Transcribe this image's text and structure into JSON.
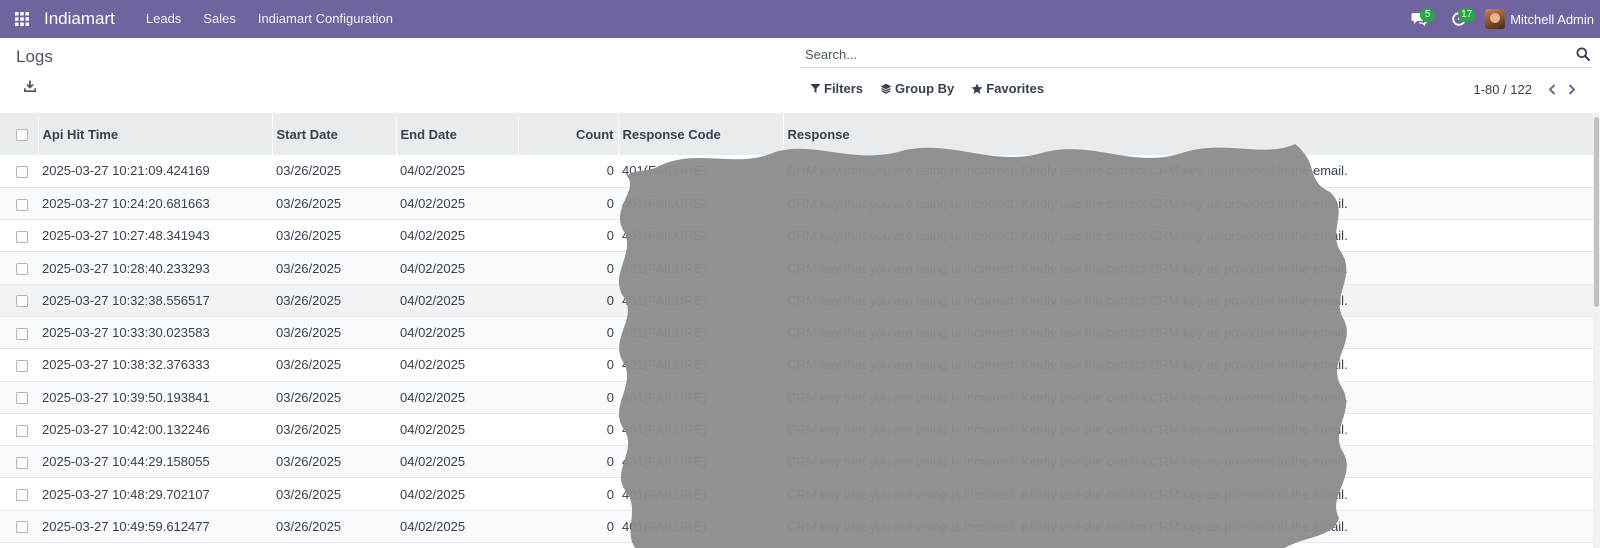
{
  "navbar": {
    "brand": "Indiamart",
    "menu": [
      "Leads",
      "Sales",
      "Indiamart Configuration"
    ],
    "messages_badge": "5",
    "activities_badge": "17",
    "user_name": "Mitchell Admin"
  },
  "control_panel": {
    "title": "Logs",
    "search_placeholder": "Search...",
    "filters_label": "Filters",
    "groupby_label": "Group By",
    "favorites_label": "Favorites",
    "pager_value": "1-80 / 122"
  },
  "table": {
    "headers": {
      "api_hit_time": "Api Hit Time",
      "start_date": "Start Date",
      "end_date": "End Date",
      "count": "Count",
      "response_code": "Response Code",
      "response": "Response"
    },
    "rows": [
      {
        "api_hit_time": "2025-03-27 10:21:09.424169",
        "start_date": "03/26/2025",
        "end_date": "04/02/2025",
        "count": "0",
        "response_code": "401(FAILURE)",
        "response": "CRM key that you are using is incorrect. Kindly use the correct CRM key as provided in the email."
      },
      {
        "api_hit_time": "2025-03-27 10:24:20.681663",
        "start_date": "03/26/2025",
        "end_date": "04/02/2025",
        "count": "0",
        "response_code": "401(FAILURE)",
        "response": "CRM key that you are using is incorrect. Kindly use the correct CRM key as provided in the email."
      },
      {
        "api_hit_time": "2025-03-27 10:27:48.341943",
        "start_date": "03/26/2025",
        "end_date": "04/02/2025",
        "count": "0",
        "response_code": "401(FAILURE)",
        "response": "CRM key that you are using is incorrect. Kindly use the correct CRM key as provided in the email."
      },
      {
        "api_hit_time": "2025-03-27 10:28:40.233293",
        "start_date": "03/26/2025",
        "end_date": "04/02/2025",
        "count": "0",
        "response_code": "401(FAILURE)",
        "response": "CRM key that you are using is incorrect. Kindly use the correct CRM key as provided in the email."
      },
      {
        "api_hit_time": "2025-03-27 10:32:38.556517",
        "start_date": "03/26/2025",
        "end_date": "04/02/2025",
        "count": "0",
        "response_code": "401(FAILURE)",
        "response": "CRM key that you are using is incorrect. Kindly use the correct CRM key as provided in the email."
      },
      {
        "api_hit_time": "2025-03-27 10:33:30.023583",
        "start_date": "03/26/2025",
        "end_date": "04/02/2025",
        "count": "0",
        "response_code": "401(FAILURE)",
        "response": "CRM key that you are using is incorrect. Kindly use the correct CRM key as provided in the email."
      },
      {
        "api_hit_time": "2025-03-27 10:38:32.376333",
        "start_date": "03/26/2025",
        "end_date": "04/02/2025",
        "count": "0",
        "response_code": "401(FAILURE)",
        "response": "CRM key that you are using is incorrect. Kindly use the correct CRM key as provided in the email."
      },
      {
        "api_hit_time": "2025-03-27 10:39:50.193841",
        "start_date": "03/26/2025",
        "end_date": "04/02/2025",
        "count": "0",
        "response_code": "401(FAILURE)",
        "response": "CRM key that you are using is incorrect. Kindly use the correct CRM key as provided in the email."
      },
      {
        "api_hit_time": "2025-03-27 10:42:00.132246",
        "start_date": "03/26/2025",
        "end_date": "04/02/2025",
        "count": "0",
        "response_code": "401(FAILURE)",
        "response": "CRM key that you are using is incorrect. Kindly use the correct CRM key as provided in the email."
      },
      {
        "api_hit_time": "2025-03-27 10:44:29.158055",
        "start_date": "03/26/2025",
        "end_date": "04/02/2025",
        "count": "0",
        "response_code": "401(FAILURE)",
        "response": "CRM key that you are using is incorrect. Kindly use the correct CRM key as provided in the email."
      },
      {
        "api_hit_time": "2025-03-27 10:48:29.702107",
        "start_date": "03/26/2025",
        "end_date": "04/02/2025",
        "count": "0",
        "response_code": "401(FAILURE)",
        "response": "CRM key that you are using is incorrect. Kindly use the correct CRM key as provided in the email."
      },
      {
        "api_hit_time": "2025-03-27 10:49:59.612477",
        "start_date": "03/26/2025",
        "end_date": "04/02/2025",
        "count": "0",
        "response_code": "401(FAILURE)",
        "response": "CRM key that you are using is incorrect. Kindly use the correct CRM key as provided in the email."
      }
    ]
  },
  "colors": {
    "navbar": "#71639e",
    "badge": "#28a745",
    "header_row": "#e9ecef",
    "redaction": "#8c8c8c"
  },
  "icons": {
    "apps": "grid-icon",
    "messages": "chat-icon",
    "activities": "clock-icon",
    "download": "download-icon",
    "search": "search-icon",
    "filters": "filter-icon",
    "group_by": "layers-icon",
    "favorites": "star-icon",
    "pager_prev": "chevron-left-icon",
    "pager_next": "chevron-right-icon"
  }
}
